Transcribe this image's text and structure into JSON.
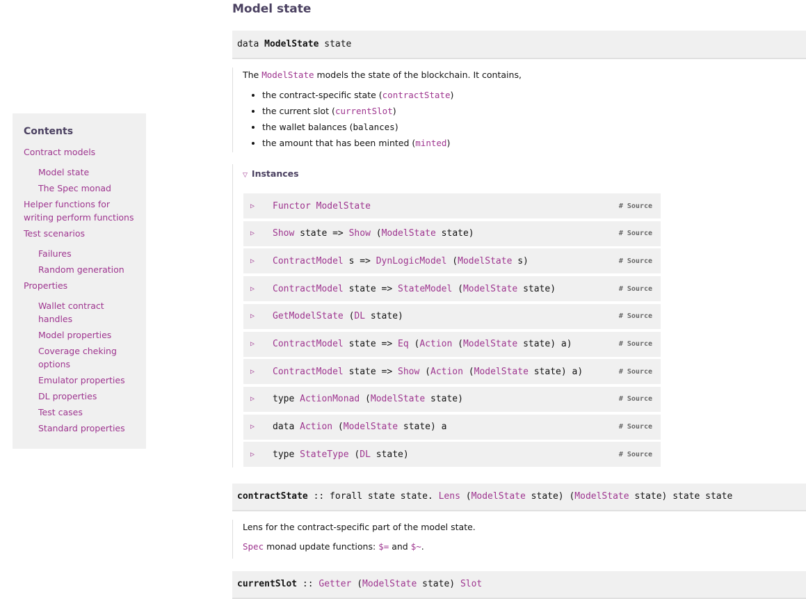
{
  "toc": {
    "title": "Contents",
    "items": [
      {
        "label": "Contract models",
        "level": 1
      },
      {
        "label": "Model state",
        "level": 2
      },
      {
        "label": "The Spec monad",
        "level": 2
      },
      {
        "label": "Helper functions for writing perform functions",
        "level": 1
      },
      {
        "label": "Test scenarios",
        "level": 1
      },
      {
        "label": "Failures",
        "level": 2
      },
      {
        "label": "Random generation",
        "level": 2
      },
      {
        "label": "Properties",
        "level": 1
      },
      {
        "label": "Wallet contract handles",
        "level": 2
      },
      {
        "label": "Model properties",
        "level": 2
      },
      {
        "label": "Coverage cheking options",
        "level": 2
      },
      {
        "label": "Emulator properties",
        "level": 2
      },
      {
        "label": "DL properties",
        "level": 2
      },
      {
        "label": "Test cases",
        "level": 2
      },
      {
        "label": "Standard properties",
        "level": 2
      }
    ]
  },
  "section_title": "Model state",
  "model_state_sig": {
    "kw": "data",
    "name": "ModelState",
    "arg": "state"
  },
  "model_state_doc": {
    "intro_pre": "The ",
    "intro_code": "ModelState",
    "intro_post": " models the state of the blockchain. It contains,",
    "bullets": [
      {
        "pre": "the contract-specific state (",
        "code": "contractState",
        "post": ")",
        "linked": true
      },
      {
        "pre": "the current slot (",
        "code": "currentSlot",
        "post": ")",
        "linked": true
      },
      {
        "pre": "the wallet balances (",
        "code": "balances",
        "post": ")",
        "linked": false
      },
      {
        "pre": "the amount that has been minted (",
        "code": "minted",
        "post": ")",
        "linked": true
      }
    ]
  },
  "instances": {
    "label": "Instances",
    "source_label": "Source",
    "source_hash": "#",
    "rows": [
      [
        {
          "t": "Functor",
          "l": true
        },
        {
          "t": " "
        },
        {
          "t": "ModelState",
          "l": true
        }
      ],
      [
        {
          "t": "Show",
          "l": true
        },
        {
          "t": " state => "
        },
        {
          "t": "Show",
          "l": true
        },
        {
          "t": " ("
        },
        {
          "t": "ModelState",
          "l": true
        },
        {
          "t": " state)"
        }
      ],
      [
        {
          "t": "ContractModel",
          "l": true
        },
        {
          "t": " s => "
        },
        {
          "t": "DynLogicModel",
          "l": true
        },
        {
          "t": " ("
        },
        {
          "t": "ModelState",
          "l": true
        },
        {
          "t": " s)"
        }
      ],
      [
        {
          "t": "ContractModel",
          "l": true
        },
        {
          "t": " state => "
        },
        {
          "t": "StateModel",
          "l": true
        },
        {
          "t": " ("
        },
        {
          "t": "ModelState",
          "l": true
        },
        {
          "t": " state)"
        }
      ],
      [
        {
          "t": "GetModelState",
          "l": true
        },
        {
          "t": " ("
        },
        {
          "t": "DL",
          "l": true
        },
        {
          "t": " state)"
        }
      ],
      [
        {
          "t": "ContractModel",
          "l": true
        },
        {
          "t": " state => "
        },
        {
          "t": "Eq",
          "l": true
        },
        {
          "t": " ("
        },
        {
          "t": "Action",
          "l": true
        },
        {
          "t": " ("
        },
        {
          "t": "ModelState",
          "l": true
        },
        {
          "t": " state) a)"
        }
      ],
      [
        {
          "t": "ContractModel",
          "l": true
        },
        {
          "t": " state => "
        },
        {
          "t": "Show",
          "l": true
        },
        {
          "t": " ("
        },
        {
          "t": "Action",
          "l": true
        },
        {
          "t": " ("
        },
        {
          "t": "ModelState",
          "l": true
        },
        {
          "t": " state) a)"
        }
      ],
      [
        {
          "t": "type "
        },
        {
          "t": "ActionMonad",
          "l": true
        },
        {
          "t": " ("
        },
        {
          "t": "ModelState",
          "l": true
        },
        {
          "t": " state)"
        }
      ],
      [
        {
          "t": "data "
        },
        {
          "t": "Action",
          "l": true
        },
        {
          "t": " ("
        },
        {
          "t": "ModelState",
          "l": true
        },
        {
          "t": " state) a"
        }
      ],
      [
        {
          "t": "type "
        },
        {
          "t": "StateType",
          "l": true
        },
        {
          "t": " ("
        },
        {
          "t": "DL",
          "l": true
        },
        {
          "t": " state)"
        }
      ]
    ]
  },
  "contract_state_sig": [
    {
      "t": "contractState",
      "b": true
    },
    {
      "t": " :: forall state state. "
    },
    {
      "t": "Lens",
      "l": true
    },
    {
      "t": " ("
    },
    {
      "t": "ModelState",
      "l": true
    },
    {
      "t": " state) ("
    },
    {
      "t": "ModelState",
      "l": true
    },
    {
      "t": " state) state state"
    }
  ],
  "contract_state_doc": {
    "line1": "Lens for the contract-specific part of the model state.",
    "line2_code1": "Spec",
    "line2_mid": " monad update functions: ",
    "line2_code2": "$=",
    "line2_and": " and ",
    "line2_code3": "$~",
    "line2_end": "."
  },
  "current_slot_sig": [
    {
      "t": "currentSlot",
      "b": true
    },
    {
      "t": " :: "
    },
    {
      "t": "Getter",
      "l": true
    },
    {
      "t": " ("
    },
    {
      "t": "ModelState",
      "l": true
    },
    {
      "t": " state) "
    },
    {
      "t": "Slot",
      "l": true
    }
  ]
}
